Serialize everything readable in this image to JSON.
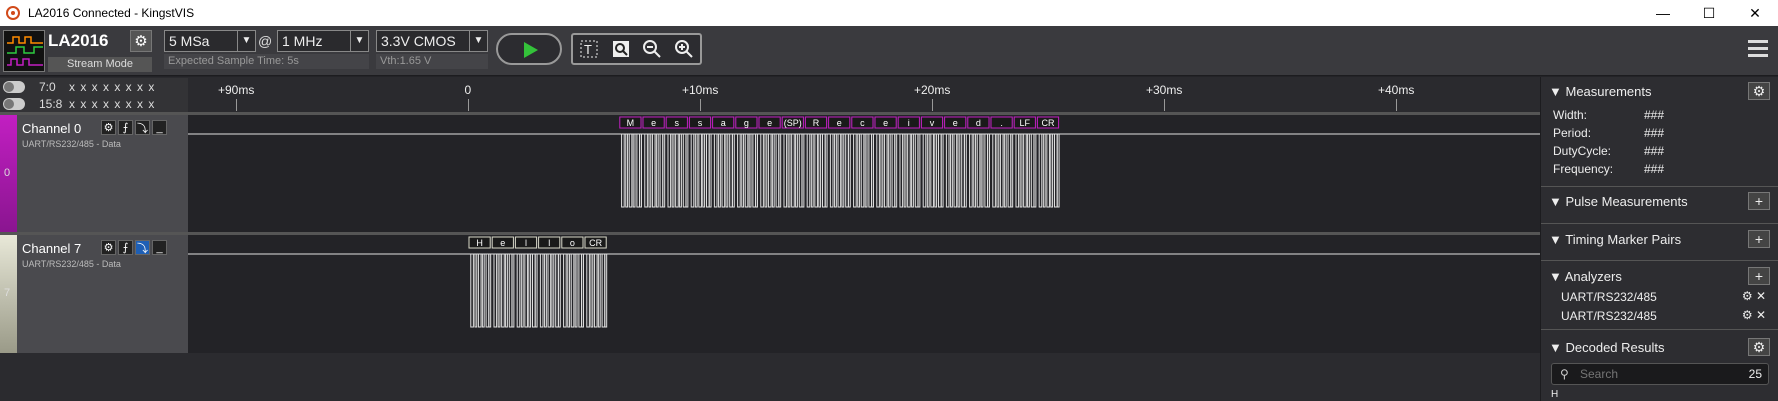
{
  "window": {
    "title": "LA2016 Connected - KingstVIS",
    "minimize": "—",
    "maximize": "☐",
    "close": "✕"
  },
  "device": {
    "name": "LA2016",
    "mode": "Stream Mode"
  },
  "sample_depth": {
    "value": "5 MSa",
    "caption": "Expected Sample Time: 5s"
  },
  "at_symbol": "@",
  "sample_rate": {
    "value": "1 MHz"
  },
  "threshold": {
    "value": "3.3V CMOS",
    "caption": "Vth:1.65 V"
  },
  "groups": [
    {
      "label": "7:0",
      "bits": "x x x x x x x x"
    },
    {
      "label": "15:8",
      "bits": "x x x x x x x x"
    }
  ],
  "ruler": {
    "ticks": [
      {
        "label": "+90ms",
        "ms": -10
      },
      {
        "label": "0",
        "ms": 0
      },
      {
        "label": "+10ms",
        "ms": 10
      },
      {
        "label": "+20ms",
        "ms": 20
      },
      {
        "label": "+30ms",
        "ms": 30
      },
      {
        "label": "+40ms",
        "ms": 40
      }
    ]
  },
  "channels": [
    {
      "name": "Channel 0",
      "index": "0",
      "analyzer": "UART/RS232/485 - Data",
      "color": "#c21fc2",
      "frames": [
        "M",
        "e",
        "s",
        "s",
        "a",
        "g",
        "e",
        "(SP)",
        "R",
        "e",
        "c",
        "e",
        "i",
        "v",
        "e",
        "d",
        ".",
        "LF",
        "CR"
      ],
      "start_ms": 6.5
    },
    {
      "name": "Channel 7",
      "index": "7",
      "analyzer": "UART/RS232/485 - Data",
      "color": "#d8d8c8",
      "frames": [
        "H",
        "e",
        "l",
        "l",
        "o",
        "CR"
      ],
      "start_ms": 0
    }
  ],
  "right_panel": {
    "measurements": {
      "title": "Measurements",
      "rows": [
        {
          "key": "Width:",
          "value": "###"
        },
        {
          "key": "Period:",
          "value": "###"
        },
        {
          "key": "DutyCycle:",
          "value": "###"
        },
        {
          "key": "Frequency:",
          "value": "###"
        }
      ]
    },
    "pulse": {
      "title": "Pulse Measurements"
    },
    "timing": {
      "title": "Timing Marker Pairs"
    },
    "analyzers": {
      "title": "Analyzers",
      "items": [
        "UART/RS232/485",
        "UART/RS232/485"
      ]
    },
    "decoded": {
      "title": "Decoded Results",
      "search_placeholder": "Search",
      "count": "25",
      "first_row": "H"
    }
  },
  "colors": {
    "accent_magenta": "#c21fc2",
    "play_green": "#34c23a"
  }
}
